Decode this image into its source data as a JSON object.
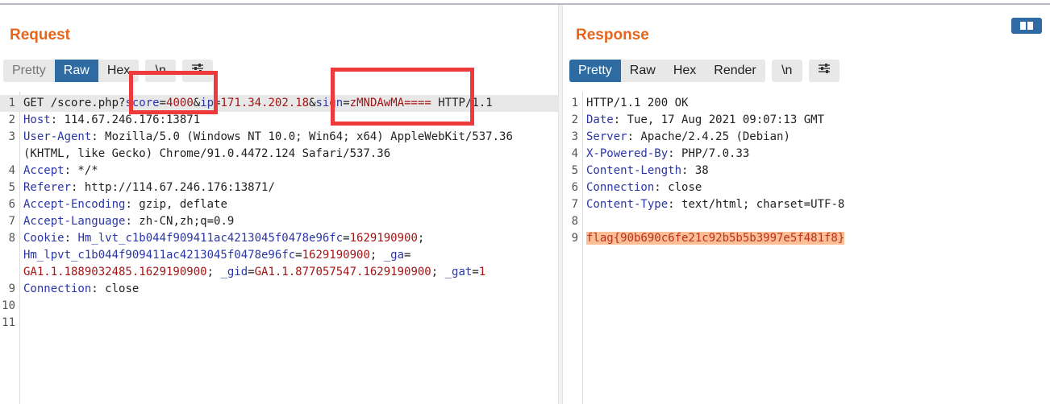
{
  "request": {
    "title": "Request",
    "tabs": [
      "Pretty",
      "Raw",
      "Hex"
    ],
    "newline_btn": "\\n",
    "lines": [
      {
        "num": "1",
        "parts": [
          [
            "t",
            "GET /score.php?"
          ],
          [
            "k",
            "score"
          ],
          [
            "t",
            "="
          ],
          [
            "v",
            "4000"
          ],
          [
            "t",
            "&"
          ],
          [
            "k",
            "ip"
          ],
          [
            "t",
            "="
          ],
          [
            "v",
            "171.34.202.18"
          ],
          [
            "t",
            "&"
          ],
          [
            "k",
            "sign"
          ],
          [
            "t",
            "="
          ],
          [
            "v",
            "zMNDAwMA===="
          ],
          [
            "t",
            " HTTP/1.1"
          ]
        ]
      },
      {
        "num": "2",
        "parts": [
          [
            "k",
            "Host"
          ],
          [
            "t",
            ": 114.67.246.176:13871"
          ]
        ]
      },
      {
        "num": "3",
        "parts": [
          [
            "k",
            "User-Agent"
          ],
          [
            "t",
            ": Mozilla/5.0 (Windows NT 10.0; Win64; x64) AppleWebKit/537.36"
          ]
        ]
      },
      {
        "num": "",
        "parts": [
          [
            "t",
            "(KHTML, like Gecko) Chrome/91.0.4472.124 Safari/537.36"
          ]
        ]
      },
      {
        "num": "4",
        "parts": [
          [
            "k",
            "Accept"
          ],
          [
            "t",
            ": */*"
          ]
        ]
      },
      {
        "num": "5",
        "parts": [
          [
            "k",
            "Referer"
          ],
          [
            "t",
            ": http://114.67.246.176:13871/"
          ]
        ]
      },
      {
        "num": "6",
        "parts": [
          [
            "k",
            "Accept-Encoding"
          ],
          [
            "t",
            ": gzip, deflate"
          ]
        ]
      },
      {
        "num": "7",
        "parts": [
          [
            "k",
            "Accept-Language"
          ],
          [
            "t",
            ": zh-CN,zh;q=0.9"
          ]
        ]
      },
      {
        "num": "8",
        "parts": [
          [
            "k",
            "Cookie"
          ],
          [
            "t",
            ": "
          ],
          [
            "k",
            "Hm_lvt_c1b044f909411ac4213045f0478e96fc"
          ],
          [
            "t",
            "="
          ],
          [
            "v",
            "1629190900"
          ],
          [
            "t",
            ";"
          ]
        ]
      },
      {
        "num": "",
        "parts": [
          [
            "k",
            "Hm_lpvt_c1b044f909411ac4213045f0478e96fc"
          ],
          [
            "t",
            "="
          ],
          [
            "v",
            "1629190900"
          ],
          [
            "t",
            "; "
          ],
          [
            "k",
            "_ga"
          ],
          [
            "t",
            "="
          ]
        ]
      },
      {
        "num": "",
        "parts": [
          [
            "v",
            "GA1.1.1889032485.1629190900"
          ],
          [
            "t",
            "; "
          ],
          [
            "k",
            "_gid"
          ],
          [
            "t",
            "="
          ],
          [
            "v",
            "GA1.1.877057547.1629190900"
          ],
          [
            "t",
            "; "
          ],
          [
            "k",
            "_gat"
          ],
          [
            "t",
            "="
          ],
          [
            "v",
            "1"
          ]
        ]
      },
      {
        "num": "9",
        "parts": [
          [
            "k",
            "Connection"
          ],
          [
            "t",
            ": close"
          ]
        ]
      },
      {
        "num": "10",
        "parts": []
      },
      {
        "num": "11",
        "parts": []
      }
    ]
  },
  "response": {
    "title": "Response",
    "tabs": [
      "Pretty",
      "Raw",
      "Hex",
      "Render"
    ],
    "newline_btn": "\\n",
    "lines": [
      {
        "num": "1",
        "parts": [
          [
            "t",
            "HTTP/1.1 200 OK"
          ]
        ]
      },
      {
        "num": "2",
        "parts": [
          [
            "k",
            "Date"
          ],
          [
            "t",
            ": Tue, 17 Aug 2021 09:07:13 GMT"
          ]
        ]
      },
      {
        "num": "3",
        "parts": [
          [
            "k",
            "Server"
          ],
          [
            "t",
            ": Apache/2.4.25 (Debian)"
          ]
        ]
      },
      {
        "num": "4",
        "parts": [
          [
            "k",
            "X-Powered-By"
          ],
          [
            "t",
            ": PHP/7.0.33"
          ]
        ]
      },
      {
        "num": "5",
        "parts": [
          [
            "k",
            "Content-Length"
          ],
          [
            "t",
            ": 38"
          ]
        ]
      },
      {
        "num": "6",
        "parts": [
          [
            "k",
            "Connection"
          ],
          [
            "t",
            ": close"
          ]
        ]
      },
      {
        "num": "7",
        "parts": [
          [
            "k",
            "Content-Type"
          ],
          [
            "t",
            ": text/html; charset=UTF-8"
          ]
        ]
      },
      {
        "num": "8",
        "parts": []
      },
      {
        "num": "9",
        "parts": [
          [
            "f",
            "flag{90b690c6fe21c92b5b5b3997e5f481f8}"
          ]
        ]
      }
    ]
  },
  "colors": {
    "accent": "#e8641b",
    "active_tab": "#2e6ba3",
    "header_key": "#2a36a6",
    "value": "#a31515",
    "highlight_box": "#ee3a3a",
    "flag_bg": "#fbbe95"
  }
}
